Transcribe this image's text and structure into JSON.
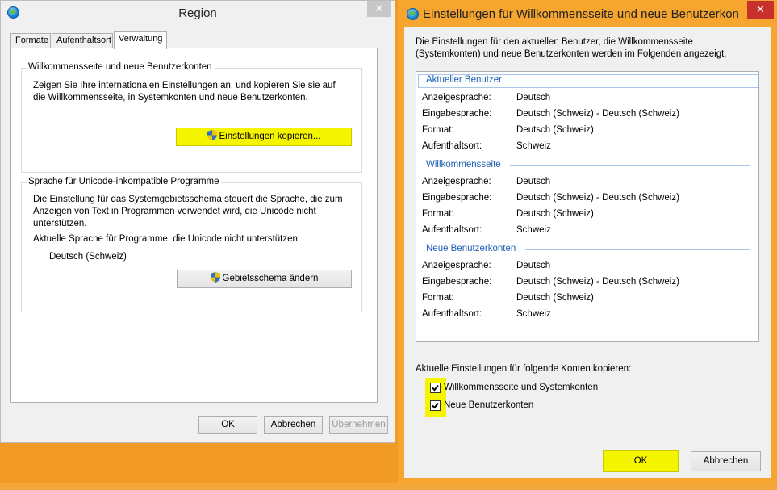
{
  "region_window": {
    "title": "Region",
    "close_icon": "close-icon",
    "tabs": [
      {
        "label": "Formate"
      },
      {
        "label": "Aufenthaltsort"
      },
      {
        "label": "Verwaltung"
      }
    ],
    "welcome_group": {
      "title": "Willkommensseite und neue Benutzerkonten",
      "description_line1": "Zeigen Sie Ihre internationalen Einstellungen an, und kopieren Sie sie auf",
      "description_line2": "die Willkommensseite, in Systemkonten und neue Benutzerkonten.",
      "copy_button": "Einstellungen kopieren..."
    },
    "unicode_group": {
      "title": "Sprache für Unicode-inkompatible Programme",
      "description_line1": "Die Einstellung für das Systemgebietsschema steuert die Sprache, die zum",
      "description_line2": "Anzeigen von Text in Programmen verwendet wird, die Unicode nicht",
      "description_line3": "unterstützen.",
      "current_label": "Aktuelle Sprache für Programme, die Unicode nicht unterstützen:",
      "current_value": "Deutsch (Schweiz)",
      "change_button": "Gebietsschema ändern"
    },
    "buttons": {
      "ok": "OK",
      "cancel": "Abbrechen",
      "apply": "Übernehmen"
    }
  },
  "copy_dialog": {
    "title": "Einstellungen für Willkommensseite und neue Benutzerkon",
    "intro_line1": "Die Einstellungen für den aktuellen Benutzer, die Willkommensseite",
    "intro_line2": "(Systemkonten) und neue Benutzerkonten werden im Folgenden angezeigt.",
    "sections": [
      {
        "heading": "Aktueller Benutzer",
        "rows": [
          {
            "label": "Anzeigesprache:",
            "value": "Deutsch"
          },
          {
            "label": "Eingabesprache:",
            "value": "Deutsch (Schweiz) - Deutsch (Schweiz)"
          },
          {
            "label": "Format:",
            "value": "Deutsch (Schweiz)"
          },
          {
            "label": "Aufenthaltsort:",
            "value": "Schweiz"
          }
        ]
      },
      {
        "heading": "Willkommensseite",
        "rows": [
          {
            "label": "Anzeigesprache:",
            "value": "Deutsch"
          },
          {
            "label": "Eingabesprache:",
            "value": "Deutsch (Schweiz) - Deutsch (Schweiz)"
          },
          {
            "label": "Format:",
            "value": "Deutsch (Schweiz)"
          },
          {
            "label": "Aufenthaltsort:",
            "value": "Schweiz"
          }
        ]
      },
      {
        "heading": "Neue Benutzerkonten",
        "rows": [
          {
            "label": "Anzeigesprache:",
            "value": "Deutsch"
          },
          {
            "label": "Eingabesprache:",
            "value": "Deutsch (Schweiz) - Deutsch (Schweiz)"
          },
          {
            "label": "Format:",
            "value": "Deutsch (Schweiz)"
          },
          {
            "label": "Aufenthaltsort:",
            "value": "Schweiz"
          }
        ]
      }
    ],
    "copy_label": "Aktuelle Einstellungen für folgende Konten kopieren:",
    "checkboxes": [
      {
        "label": "Willkommensseite und Systemkonten",
        "checked": true
      },
      {
        "label": "Neue Benutzerkonten",
        "checked": true
      }
    ],
    "buttons": {
      "ok": "OK",
      "cancel": "Abbrechen"
    }
  },
  "colors": {
    "highlight": "#f5f500",
    "desktop": "#f19a25",
    "section_heading": "#1e5fb4"
  }
}
